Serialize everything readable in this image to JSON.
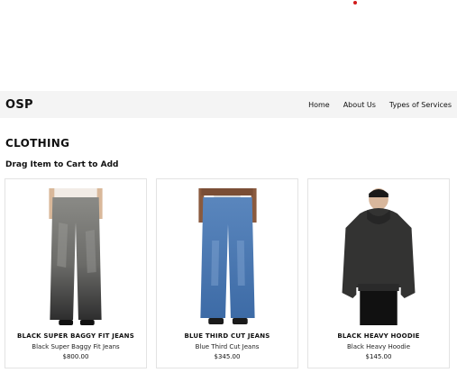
{
  "navbar": {
    "brand": "OSP",
    "links": [
      "Home",
      "About Us",
      "Types of Services"
    ]
  },
  "section": {
    "title": "CLOTHING",
    "subtitle": "Drag Item to Cart to Add"
  },
  "products": [
    {
      "name": "BLACK SUPER BAGGY FIT JEANS",
      "description": "Black Super Baggy Fit Jeans",
      "price": "$800.00",
      "image": "jeans-gray-photo"
    },
    {
      "name": "BLUE THIRD CUT JEANS",
      "description": "Blue Third Cut Jeans",
      "price": "$345.00",
      "image": "jeans-blue-photo"
    },
    {
      "name": "BLACK HEAVY HOODIE",
      "description": "Black Heavy Hoodie",
      "price": "$145.00",
      "image": "hoodie-black-photo"
    }
  ],
  "colors": {
    "navbar_bg": "#f4f4f4",
    "accent_dot": "#d11a1a"
  }
}
